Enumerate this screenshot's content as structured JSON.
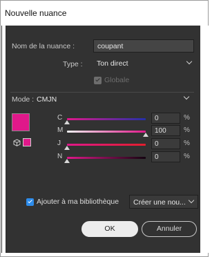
{
  "window": {
    "title": "Nouvelle nuance"
  },
  "form": {
    "name_label": "Nom de la nuance :",
    "name_value": "coupant",
    "type_label": "Type :",
    "type_value": "Ton direct",
    "global_label": "Globale",
    "global_checked": true,
    "global_disabled": true,
    "mode_label": "Mode :",
    "mode_value": "CMJN"
  },
  "color": {
    "swatch_hex": "#e0188a"
  },
  "sliders": [
    {
      "label": "C",
      "value": "0",
      "unit": "%",
      "fraction": 0.0,
      "gradient": "linear-gradient(to right, #e0188a, #2430a8)"
    },
    {
      "label": "M",
      "value": "100",
      "unit": "%",
      "fraction": 1.0,
      "gradient": "linear-gradient(to right, #f2f2f2, #e0188a)"
    },
    {
      "label": "J",
      "value": "0",
      "unit": "%",
      "fraction": 0.0,
      "gradient": "linear-gradient(to right, #e0188a, #e31e2d)"
    },
    {
      "label": "N",
      "value": "0",
      "unit": "%",
      "fraction": 0.0,
      "gradient": "linear-gradient(to right, #e0188a, #140410)"
    }
  ],
  "library": {
    "add_label": "Ajouter à ma bibliothèque",
    "add_checked": true,
    "target_value": "Créer une nou..."
  },
  "buttons": {
    "ok_label": "OK",
    "cancel_label": "Annuler"
  },
  "accent": "#2d8ceb"
}
